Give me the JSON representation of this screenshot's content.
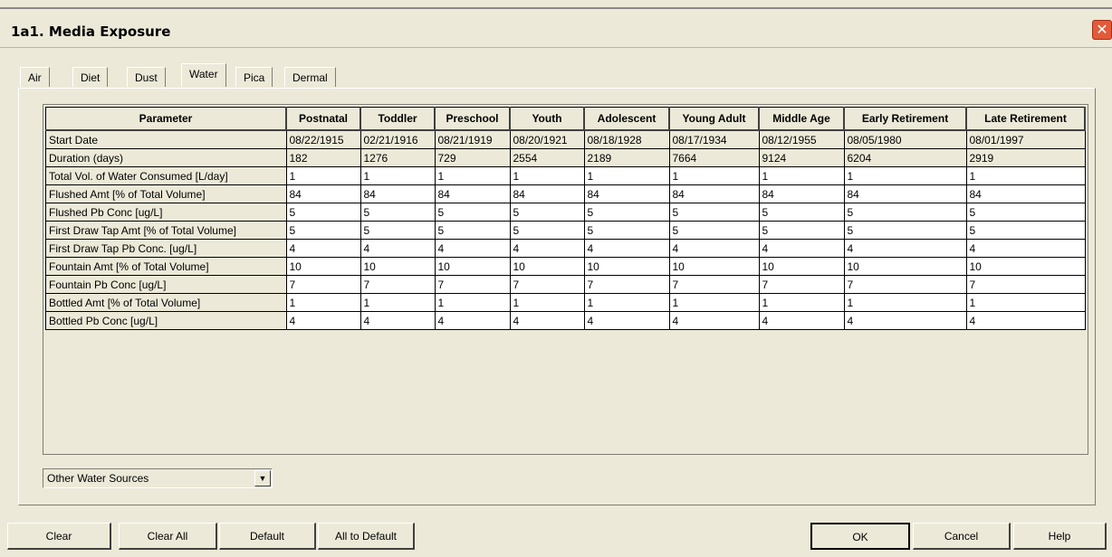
{
  "window": {
    "title": "1a1. Media Exposure",
    "close_glyph": "✕"
  },
  "tabs": [
    "Air",
    "Diet",
    "Dust",
    "Water",
    "Pica",
    "Dermal"
  ],
  "active_tab": "Water",
  "table": {
    "columns": [
      "Parameter",
      "Postnatal",
      "Toddler",
      "Preschool",
      "Youth",
      "Adolescent",
      "Young Adult",
      "Middle Age",
      "Early Retirement",
      "Late Retirement"
    ],
    "rows": [
      {
        "label": "Start Date",
        "values": [
          "08/22/1915",
          "02/21/1916",
          "08/21/1919",
          "08/20/1921",
          "08/18/1928",
          "08/17/1934",
          "08/12/1955",
          "08/05/1980",
          "08/01/1997"
        ],
        "editable": false
      },
      {
        "label": "Duration (days)",
        "values": [
          "182",
          "1276",
          "729",
          "2554",
          "2189",
          "7664",
          "9124",
          "6204",
          "2919"
        ],
        "editable": false
      },
      {
        "label": "Total Vol. of Water Consumed [L/day]",
        "values": [
          "1",
          "1",
          "1",
          "1",
          "1",
          "1",
          "1",
          "1",
          "1"
        ],
        "editable": true
      },
      {
        "label": "Flushed Amt [% of Total Volume]",
        "values": [
          "84",
          "84",
          "84",
          "84",
          "84",
          "84",
          "84",
          "84",
          "84"
        ],
        "editable": true
      },
      {
        "label": "Flushed Pb Conc [ug/L]",
        "values": [
          "5",
          "5",
          "5",
          "5",
          "5",
          "5",
          "5",
          "5",
          "5"
        ],
        "editable": true
      },
      {
        "label": "First Draw Tap Amt [% of Total Volume]",
        "values": [
          "5",
          "5",
          "5",
          "5",
          "5",
          "5",
          "5",
          "5",
          "5"
        ],
        "editable": true
      },
      {
        "label": "First Draw Tap Pb Conc. [ug/L]",
        "values": [
          "4",
          "4",
          "4",
          "4",
          "4",
          "4",
          "4",
          "4",
          "4"
        ],
        "editable": true
      },
      {
        "label": "Fountain Amt [% of Total Volume]",
        "values": [
          "10",
          "10",
          "10",
          "10",
          "10",
          "10",
          "10",
          "10",
          "10"
        ],
        "editable": true
      },
      {
        "label": "Fountain Pb Conc [ug/L]",
        "values": [
          "7",
          "7",
          "7",
          "7",
          "7",
          "7",
          "7",
          "7",
          "7"
        ],
        "editable": true
      },
      {
        "label": "Bottled Amt [% of Total Volume]",
        "values": [
          "1",
          "1",
          "1",
          "1",
          "1",
          "1",
          "1",
          "1",
          "1"
        ],
        "editable": true
      },
      {
        "label": "Bottled Pb Conc [ug/L]",
        "values": [
          "4",
          "4",
          "4",
          "4",
          "4",
          "4",
          "4",
          "4",
          "4"
        ],
        "editable": true
      }
    ]
  },
  "source_select": {
    "value": "Other Water Sources",
    "arrow": "▼"
  },
  "buttons": {
    "clear": "Clear",
    "clear_all": "Clear All",
    "default": "Default",
    "all_to_default": "All to Default",
    "ok": "OK",
    "cancel": "Cancel",
    "help": "Help"
  },
  "colors": {
    "window_bg": "#ece9d8",
    "close_red": "#e35a3a"
  }
}
